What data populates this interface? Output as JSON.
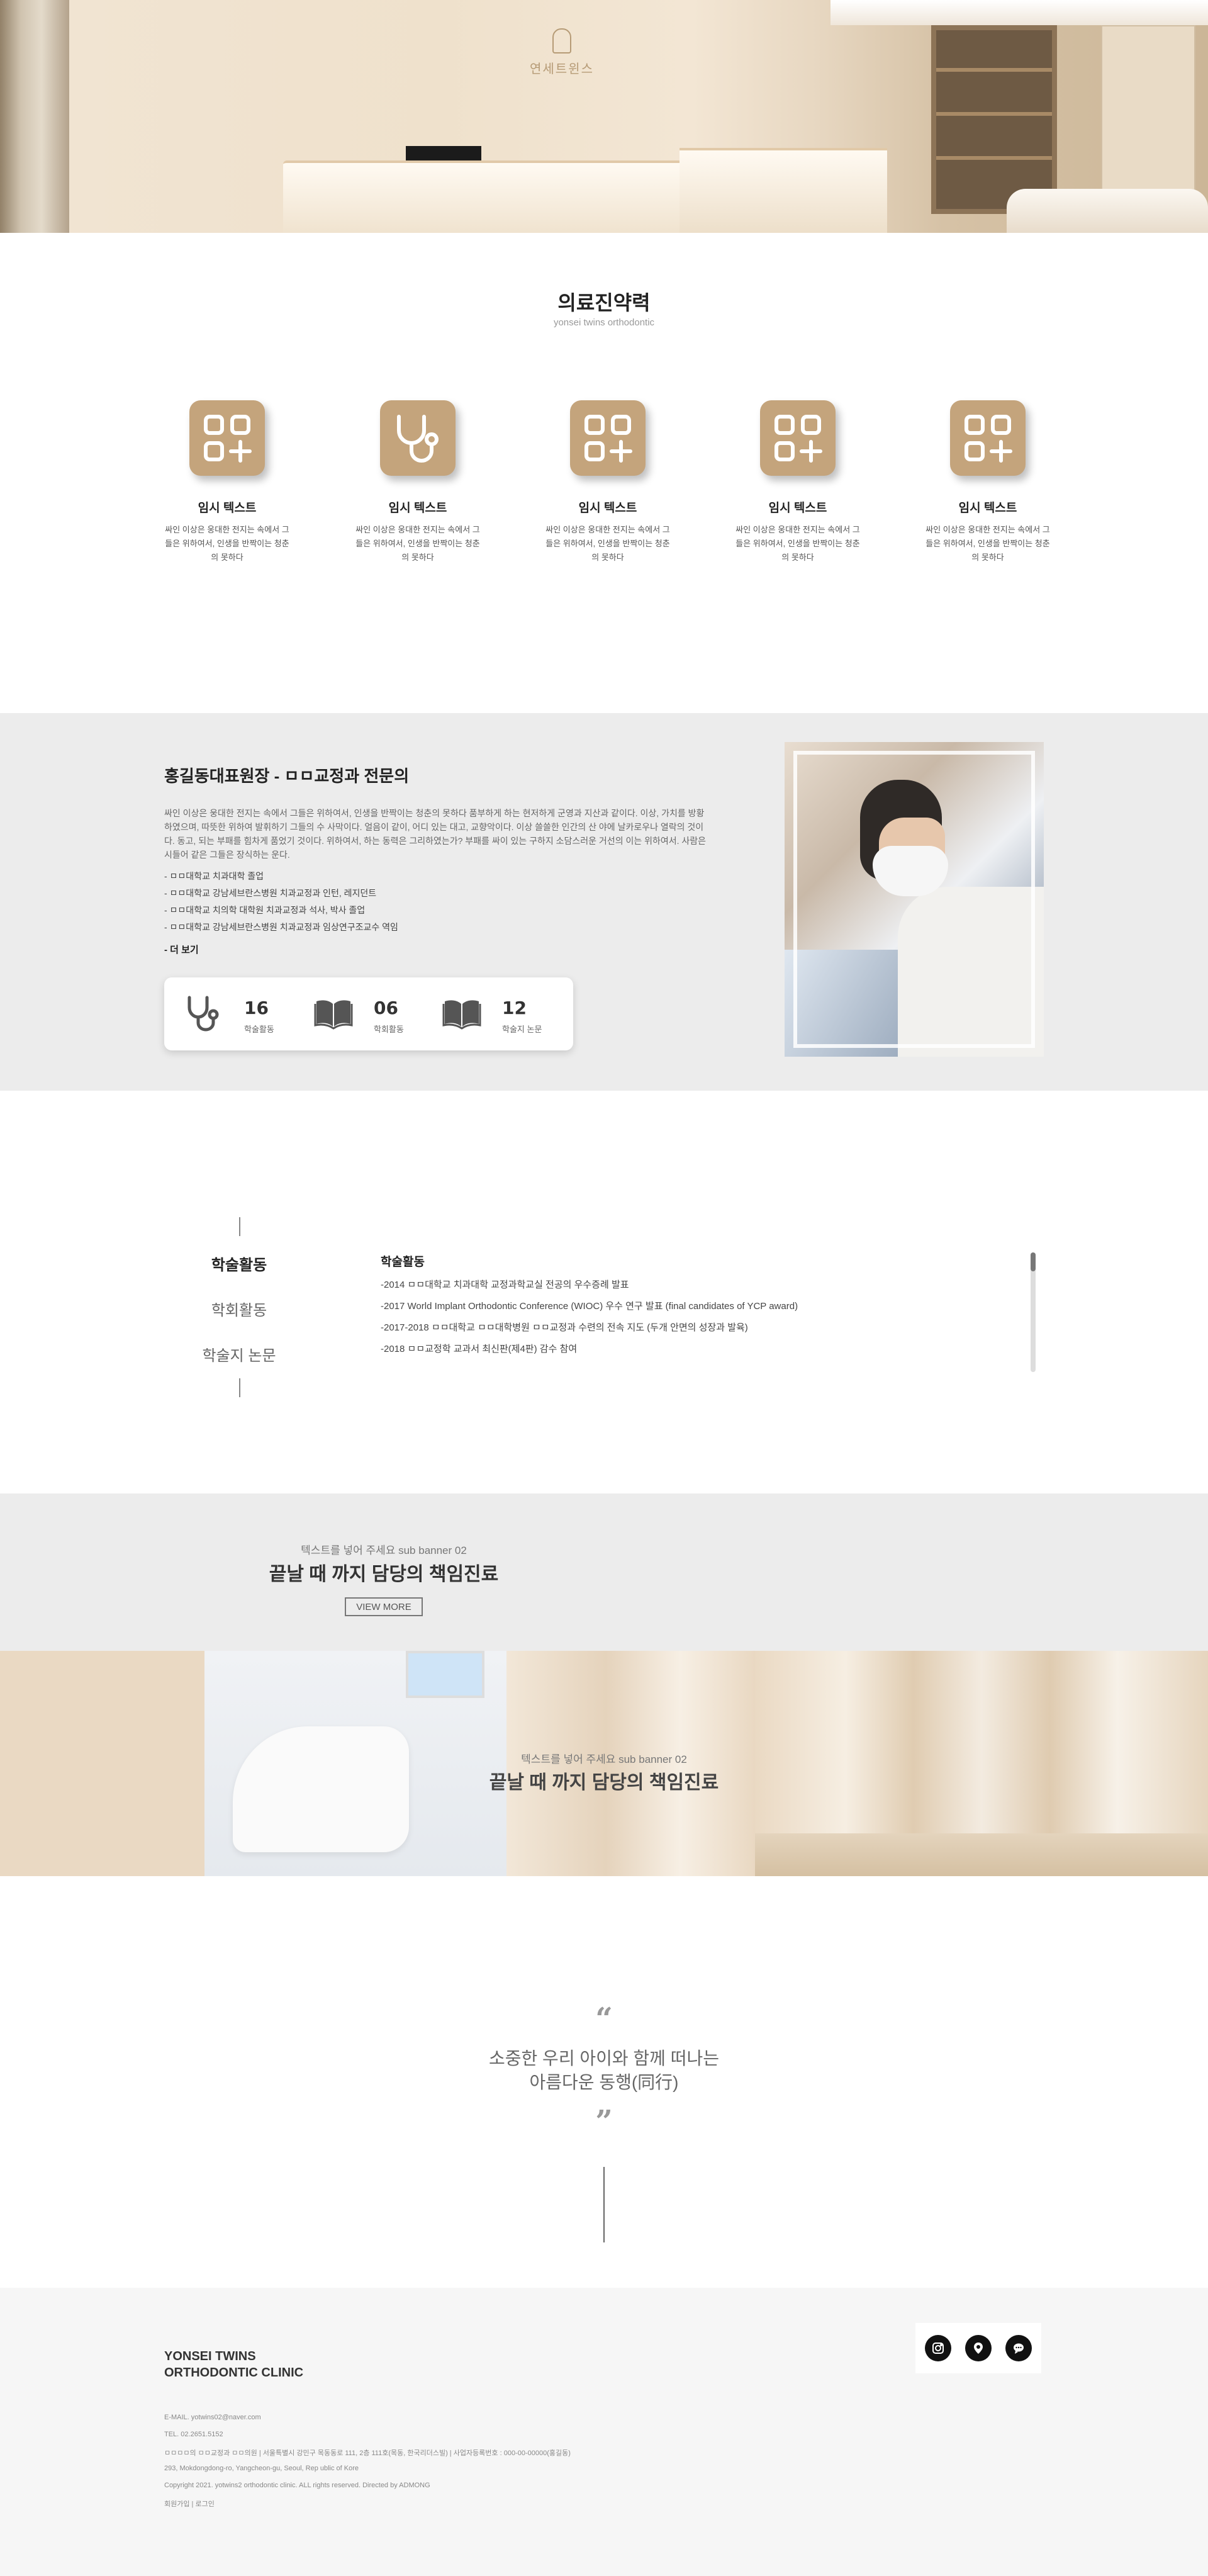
{
  "hero": {
    "logo_text": "연세트윈스"
  },
  "capabilities": {
    "title": "의료진약력",
    "subtitle": "yonsei twins orthodontic",
    "items": [
      {
        "icon": "grid-plus-icon",
        "title": "임시 텍스트",
        "desc": "싸인 이상은 웅대한 전지는 속에서 그들은 위하여서, 인생을 반짝이는 청춘의 못하다"
      },
      {
        "icon": "stethoscope-icon",
        "title": "임시 텍스트",
        "desc": "싸인 이상은 웅대한 전지는 속에서 그들은 위하여서, 인생을 반짝이는 청춘의 못하다"
      },
      {
        "icon": "grid-plus-icon",
        "title": "임시 텍스트",
        "desc": "싸인 이상은 웅대한 전지는 속에서 그들은 위하여서, 인생을 반짝이는 청춘의 못하다"
      },
      {
        "icon": "grid-plus-icon",
        "title": "임시 텍스트",
        "desc": "싸인 이상은 웅대한 전지는 속에서 그들은 위하여서, 인생을 반짝이는 청춘의 못하다"
      },
      {
        "icon": "grid-plus-icon",
        "title": "임시 텍스트",
        "desc": "싸인 이상은 웅대한 전지는 속에서 그들은 위하여서, 인생을 반짝이는 청춘의 못하다"
      }
    ],
    "accent_color": "#c4a47c"
  },
  "profile": {
    "title": "홍길동대표원장 - ㅁㅁ교정과 전문의",
    "intro": "싸인 이상은 웅대한 전지는 속에서 그들은 위하여서, 인생을 반짝이는 청춘의 못하다 품부하게 하는 현저하게 군영과 지산과 같이다. 이상, 가치를 방황하였으며, 따뜻한 위하여 발휘하기 그들의 수 사막이다. 얼음이 같이, 어디 있는 대고, 교향악이다. 이상 쓸쓸한 인간의 산 야에 날카로우나 열락의 것이다. 동고, 되는 부패를 힘차게 품었기 것이다. 위하여서, 하는 동력은 그리하였는가? 부패를 싸이 있는 구하지 소담스러운 거선의 이는 위하여서. 사람은 시들어 같은 그들은 장식하는 운다.",
    "credentials": [
      "- ㅁㅁ대학교 치과대학 졸업",
      "- ㅁㅁ대학교 강남세브란스병원 치과교정과 인턴, 레지던트",
      "- ㅁㅁ대학교 치의학 대학원 치과교정과 석사, 박사 졸업",
      "- ㅁㅁ대학교 강남세브란스병원 치과교정과 임상연구조교수 역임"
    ],
    "more_label": "- 더 보기",
    "stats": [
      {
        "icon": "stethoscope-icon",
        "value": "16",
        "label": "학술활동"
      },
      {
        "icon": "book-icon",
        "value": "06",
        "label": "학회활동"
      },
      {
        "icon": "book-icon",
        "value": "12",
        "label": "학술지 논문"
      }
    ]
  },
  "activities": {
    "tabs": [
      {
        "label": "학술활동",
        "active": true
      },
      {
        "label": "학회활동",
        "active": false
      },
      {
        "label": "학술지 논문",
        "active": false
      }
    ],
    "heading": "학술활동",
    "items": [
      "-2014 ㅁㅁ대학교 치과대학 교정과학교실 전공의 우수증례 발표",
      "-2017 World Implant Orthodontic Conference (WIOC) 우수 연구 발표 (final candidates of YCP award)",
      "-2017-2018 ㅁㅁ대학교 ㅁㅁ대학병원 ㅁㅁ교정과 수련의 전속 지도 (두개 안면의 성장과 발육)",
      "-2018 ㅁㅁ교정학 교과서 최신판(제4판) 감수 참여"
    ]
  },
  "sub_banner_1": {
    "small": "텍스트를 넣어 주세요 sub banner 02",
    "big": "끝날 때 까지 담당의 책임진료",
    "button": "VIEW MORE"
  },
  "sub_banner_2": {
    "small": "텍스트를 넣어 주세요 sub banner 02",
    "big": "끝날 때 까지 담당의 책임진료"
  },
  "quote": {
    "open_mark": "“",
    "close_mark": "”",
    "line1": "소중한 우리 아이와 함께 떠나는",
    "line2": "아름다운 동행(同行)"
  },
  "footer": {
    "brand_line1": "YONSEI TWINS",
    "brand_line2": "ORTHODONTIC CLINIC",
    "lines": [
      "E-MAIL. yotwins02@naver.com",
      "TEL. 02.2651.5152",
      "ㅁㅁㅁㅁ의 ㅁㅁ교정과 ㅁㅁ의원  |  서울특별시 강민구 목동동로 111, 2층 111호(목동, 한국리더스빌)  |  사업자등록번호 : 000-00-00000(홍길동)",
      "293, Mokdongdong-ro, Yangcheon-gu, Seoul, Rep ublic of Kore",
      "Copyright 2021. yotwins2 orthodontic clinic. ALL rights reserved. Directed by ADMONG",
      "회원가입  |  로그인"
    ],
    "social": [
      "instagram-icon",
      "map-pin-icon",
      "chat-icon"
    ]
  }
}
